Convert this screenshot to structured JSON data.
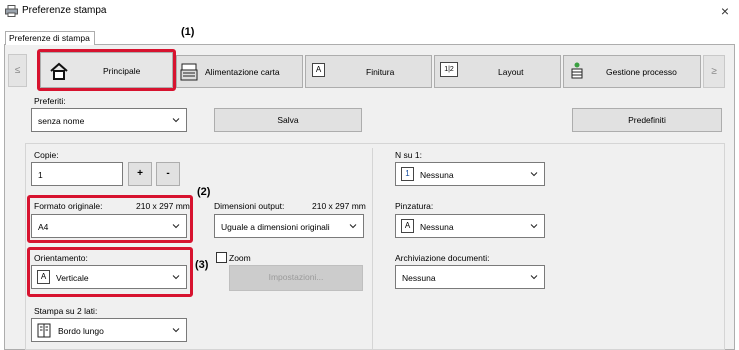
{
  "window": {
    "title": "Preferenze stampa",
    "close_glyph": "×",
    "tab": "Preferenze di stampa"
  },
  "callouts": {
    "c1": "(1)",
    "c2": "(2)",
    "c3": "(3)"
  },
  "toolbar": {
    "prev": "≤",
    "next": "≥",
    "items": [
      {
        "label": "Principale",
        "icon": "home-icon"
      },
      {
        "label": "Alimentazione carta",
        "icon": "paper-feed-icon"
      },
      {
        "label": "Finitura",
        "icon": "finishing-icon"
      },
      {
        "label": "Layout",
        "icon": "layout-icon"
      },
      {
        "label": "Gestione processo",
        "icon": "job-management-icon"
      }
    ],
    "layout_icon_text": "1|2",
    "finitura_icon_text": "A"
  },
  "favorites": {
    "label": "Preferiti:",
    "value": "senza nome",
    "save": "Salva",
    "defaults": "Predefiniti"
  },
  "copies": {
    "label": "Copie:",
    "value": "1",
    "plus": "+",
    "minus": "-"
  },
  "original_size": {
    "label": "Formato originale:",
    "dims": "210 x 297 mm",
    "value": "A4"
  },
  "output_size": {
    "label": "Dimensioni output:",
    "dims": "210 x 297 mm",
    "value": "Uguale a dimensioni originali"
  },
  "zoom": {
    "label": "Zoom",
    "settings": "Impostazioni..."
  },
  "orientation": {
    "label": "Orientamento:",
    "value": "Verticale",
    "icon_text": "A"
  },
  "duplex": {
    "label": "Stampa su 2 lati:",
    "value": "Bordo lungo"
  },
  "n_up": {
    "label": "N su 1:",
    "value": "Nessuna",
    "icon_text": "1"
  },
  "stapling": {
    "label": "Pinzatura:",
    "value": "Nessuna",
    "icon_text": "A"
  },
  "doc_filing": {
    "label": "Archiviazione documenti:",
    "value": "Nessuna"
  },
  "colors": {
    "callout_red": "#d7132f"
  }
}
